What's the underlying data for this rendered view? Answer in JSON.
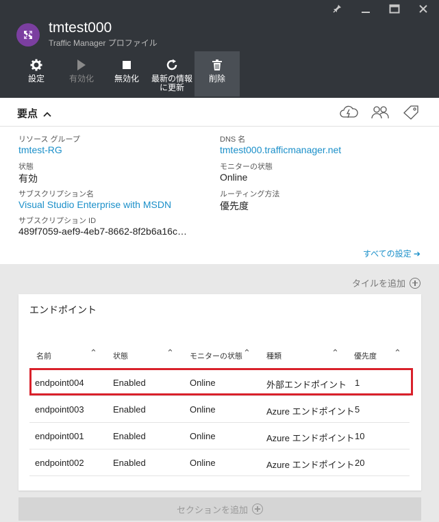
{
  "header": {
    "title": "tmtest000",
    "subtitle": "Traffic Manager プロファイル",
    "icon": "traffic-manager-icon",
    "window_controls": [
      "pin-icon",
      "minimize-icon",
      "maximize-icon",
      "close-icon"
    ]
  },
  "toolbar": {
    "settings": "設定",
    "enable": "有効化",
    "disable": "無効化",
    "refresh": "最新の情報に更新",
    "delete": "削除"
  },
  "essentials": {
    "title": "要点",
    "resource_group_label": "リソース グループ",
    "resource_group_value": "tmtest-RG",
    "status_label": "状態",
    "status_value": "有効",
    "subscription_name_label": "サブスクリプション名",
    "subscription_name_value": "Visual Studio Enterprise with MSDN",
    "subscription_id_label": "サブスクリプション ID",
    "subscription_id_value": "489f7059-aef9-4eb7-8662-8f2b6a16c…",
    "dns_label": "DNS 名",
    "dns_value": "tmtest000.trafficmanager.net",
    "monitor_status_label": "モニターの状態",
    "monitor_status_value": "Online",
    "routing_label": "ルーティング方法",
    "routing_value": "優先度",
    "all_settings": "すべての設定 ➔"
  },
  "tiles": {
    "add_tile": "タイルを追加",
    "add_section": "セクションを追加"
  },
  "endpoints": {
    "title": "エンドポイント",
    "columns": [
      "名前",
      "状態",
      "モニターの状態",
      "種類",
      "優先度"
    ],
    "rows": [
      {
        "name": "endpoint004",
        "status": "Enabled",
        "monitor": "Online",
        "type": "外部エンドポイント",
        "priority": "1"
      },
      {
        "name": "endpoint003",
        "status": "Enabled",
        "monitor": "Online",
        "type": "Azure エンドポイント",
        "priority": "5"
      },
      {
        "name": "endpoint001",
        "status": "Enabled",
        "monitor": "Online",
        "type": "Azure エンドポイント",
        "priority": "10"
      },
      {
        "name": "endpoint002",
        "status": "Enabled",
        "monitor": "Online",
        "type": "Azure エンドポイント",
        "priority": "20"
      }
    ]
  },
  "colors": {
    "header_bg": "#32363b",
    "link": "#1a8fc9",
    "highlight": "#d9202a",
    "icon_purple": "#7b3fa0"
  }
}
